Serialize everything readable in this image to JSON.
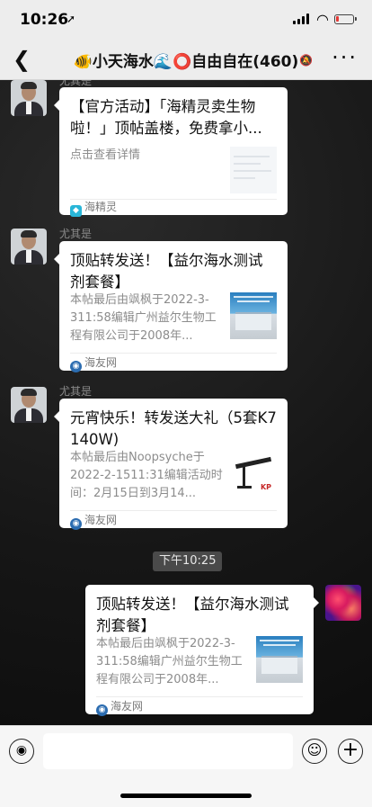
{
  "status": {
    "time": "10:26",
    "battery_color": "#e53935"
  },
  "chat": {
    "title": "🐠小天海水🌊⭕自由自在(460)"
  },
  "messages": [
    {
      "sender": "尤其是",
      "card": {
        "title": "【官方活动】「海精灵卖生物啦！」顶帖盖楼，免费拿小...",
        "description": "点击查看详情",
        "source": "海精灵",
        "source_icon": "app-icon",
        "thumbnail": "blank-post-thumbnail"
      }
    },
    {
      "sender": "尤其是",
      "card": {
        "title": "顶贴转发送！【益尔海水测试剂套餐】",
        "description": "本帖最后由飒枫于2022-3-311:58编辑广州益尔生物工程有限公司于2008年...",
        "source": "海友网",
        "source_icon": "haiyouwang-icon",
        "thumbnail": "building-thumbnail"
      }
    },
    {
      "sender": "尤其是",
      "card": {
        "title": "元宵快乐！转发送大礼（5套K7 140W)",
        "description": "本帖最后由Noopsyche于2022-2-1511:31编辑活动时间：2月15日到3月14...",
        "source": "海友网",
        "source_icon": "haiyouwang-icon",
        "thumbnail": "lamp-thumbnail"
      }
    },
    {
      "time_divider": "下午10:25",
      "card": {
        "title": "顶贴转发送！【益尔海水测试剂套餐】",
        "description": "本帖最后由飒枫于2022-3-311:58编辑广州益尔生物工程有限公司于2008年...",
        "source": "海友网",
        "source_icon": "haiyouwang-icon",
        "thumbnail": "building-thumbnail"
      }
    }
  ]
}
